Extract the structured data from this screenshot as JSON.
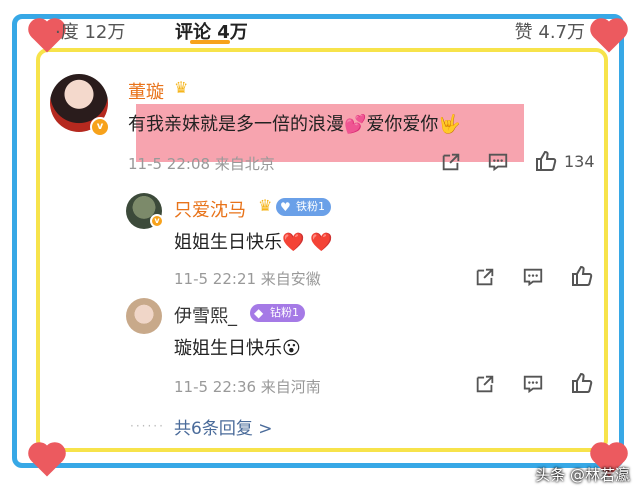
{
  "tabs": {
    "left": "·度 12万",
    "sort": "评论 4万",
    "likes": "赞 4.7万"
  },
  "post": {
    "name": "董璇",
    "text": "有我亲妹就是多一倍的浪漫💕爱你爱你🤟",
    "meta": "11-5 22:08  来自北京",
    "like_count": "134"
  },
  "replies": [
    {
      "name": "只爱沈马",
      "badge": "铁粉1",
      "text": "姐姐生日快乐❤️ ❤️",
      "meta": "11-5 22:21  来自安徽"
    },
    {
      "name": "伊雪熙_",
      "badge": "钻粉1",
      "text": "璇姐生日快乐😮",
      "meta": "11-5 22:36  来自河南"
    }
  ],
  "more_replies": "共6条回复 >",
  "watermark": "头条 @林若瀛",
  "icons": {
    "share": "share-icon",
    "comment": "comment-icon",
    "like": "thumbs-up-icon",
    "crown": "crown-icon",
    "vip": "verified-badge-icon",
    "heart": "heart-icon"
  },
  "colors": {
    "blue_frame": "#37a8e6",
    "yellow_frame": "#f7e34b",
    "heart": "#ec5a5f",
    "name": "#e8731a",
    "highlight": "#f05a6e"
  }
}
